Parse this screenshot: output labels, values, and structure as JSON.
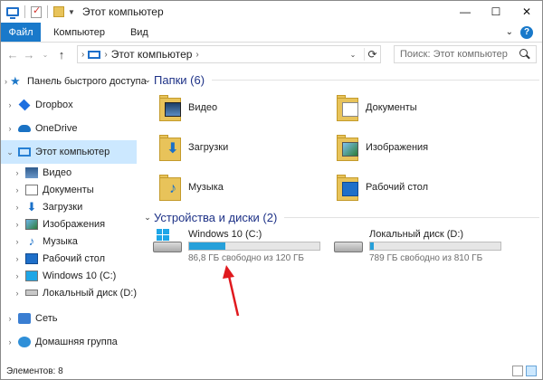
{
  "window": {
    "title": "Этот компьютер"
  },
  "ribbon": {
    "tabs": [
      "Файл",
      "Компьютер",
      "Вид"
    ]
  },
  "address": {
    "crumb": "Этот компьютер"
  },
  "search": {
    "placeholder": "Поиск: Этот компьютер"
  },
  "nav": {
    "quick_access": "Панель быстрого доступа",
    "dropbox": "Dropbox",
    "onedrive": "OneDrive",
    "this_pc": "Этот компьютер",
    "children": [
      "Видео",
      "Документы",
      "Загрузки",
      "Изображения",
      "Музыка",
      "Рабочий стол",
      "Windows 10 (C:)",
      "Локальный диск (D:)"
    ],
    "network": "Сеть",
    "homegroup": "Домашняя группа"
  },
  "folders": {
    "header": "Папки (6)",
    "items": [
      "Видео",
      "Документы",
      "Загрузки",
      "Изображения",
      "Музыка",
      "Рабочий стол"
    ]
  },
  "devices": {
    "header": "Устройства и диски (2)",
    "drives": [
      {
        "name": "Windows 10 (C:)",
        "free_text": "86,8 ГБ свободно из 120 ГБ",
        "used_fraction": 0.277
      },
      {
        "name": "Локальный диск (D:)",
        "free_text": "789 ГБ свободно из 810 ГБ",
        "used_fraction": 0.026
      }
    ]
  },
  "status": {
    "items": "Элементов: 8"
  },
  "colors": {
    "accent": "#1979ca",
    "drive_fill": "#26a0da",
    "selection": "#cce8ff",
    "arrow": "#e0191e"
  }
}
